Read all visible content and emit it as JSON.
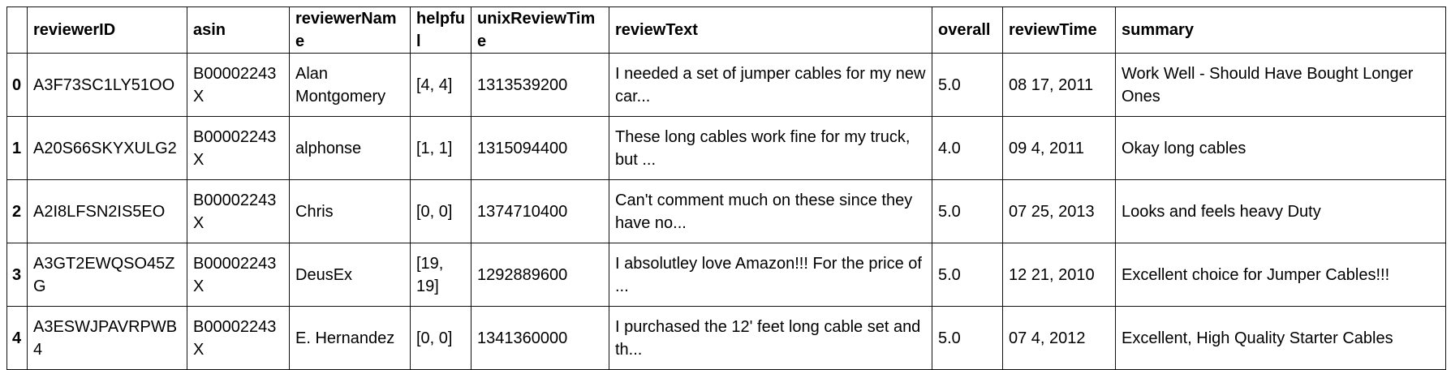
{
  "dataframe": {
    "columns": [
      "reviewerID",
      "asin",
      "reviewerName",
      "helpful",
      "unixReviewTime",
      "reviewText",
      "overall",
      "reviewTime",
      "summary"
    ],
    "rows": [
      {
        "index": "0",
        "cells": [
          "A3F73SC1LY51OO",
          "B00002243X",
          "Alan Montgomery",
          "[4, 4]",
          "1313539200",
          "I needed a set of jumper cables for my new car...",
          "5.0",
          "08 17, 2011",
          "Work Well - Should Have Bought Longer Ones"
        ]
      },
      {
        "index": "1",
        "cells": [
          "A20S66SKYXULG2",
          "B00002243X",
          "alphonse",
          "[1, 1]",
          "1315094400",
          "These long cables work fine for my truck, but ...",
          "4.0",
          "09 4, 2011",
          "Okay long cables"
        ]
      },
      {
        "index": "2",
        "cells": [
          "A2I8LFSN2IS5EO",
          "B00002243X",
          "Chris",
          "[0, 0]",
          "1374710400",
          "Can't comment much on these since they have no...",
          "5.0",
          "07 25, 2013",
          "Looks and feels heavy Duty"
        ]
      },
      {
        "index": "3",
        "cells": [
          "A3GT2EWQSO45ZG",
          "B00002243X",
          "DeusEx",
          "[19, 19]",
          "1292889600",
          "I absolutley love Amazon!!! For the price of ...",
          "5.0",
          "12 21, 2010",
          "Excellent choice for Jumper Cables!!!"
        ]
      },
      {
        "index": "4",
        "cells": [
          "A3ESWJPAVRPWB4",
          "B00002243X",
          "E. Hernandez",
          "[0, 0]",
          "1341360000",
          "I purchased the 12' feet long cable set and th...",
          "5.0",
          "07 4, 2012",
          "Excellent, High Quality Starter Cables"
        ]
      }
    ]
  }
}
